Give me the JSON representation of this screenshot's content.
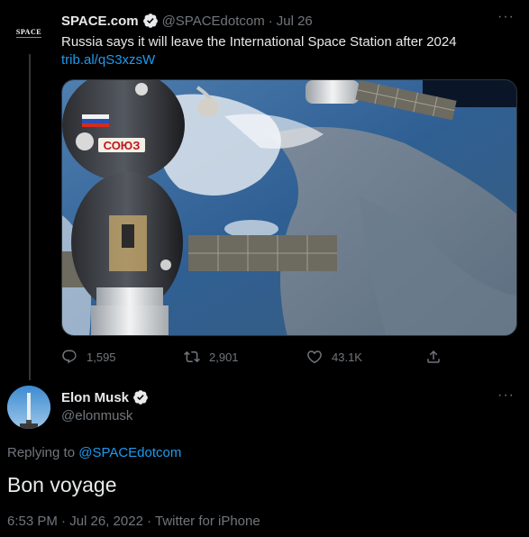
{
  "parent_tweet": {
    "avatar_logo": "SPACE",
    "name": "SPACE.com",
    "handle": "@SPACEdotcom",
    "separator": "·",
    "date": "Jul 26",
    "text": "Russia says it will leave the International Space Station after 2024",
    "link": "trib.al/qS3xzsW",
    "image_label": "СОЮЗ",
    "actions": {
      "reply_count": "1,595",
      "retweet_count": "2,901",
      "like_count": "43.1K"
    },
    "more_label": "···"
  },
  "main_tweet": {
    "name": "Elon Musk",
    "handle": "@elonmusk",
    "replying_prefix": "Replying to ",
    "replying_to": "@SPACEdotcom",
    "text": "Bon voyage",
    "meta": "6:53 PM · Jul 26, 2022 · Twitter for iPhone",
    "more_label": "···"
  },
  "colors": {
    "background": "#000000",
    "text": "#e7e9ea",
    "muted": "#71767b",
    "accent": "#1d9bf0"
  }
}
